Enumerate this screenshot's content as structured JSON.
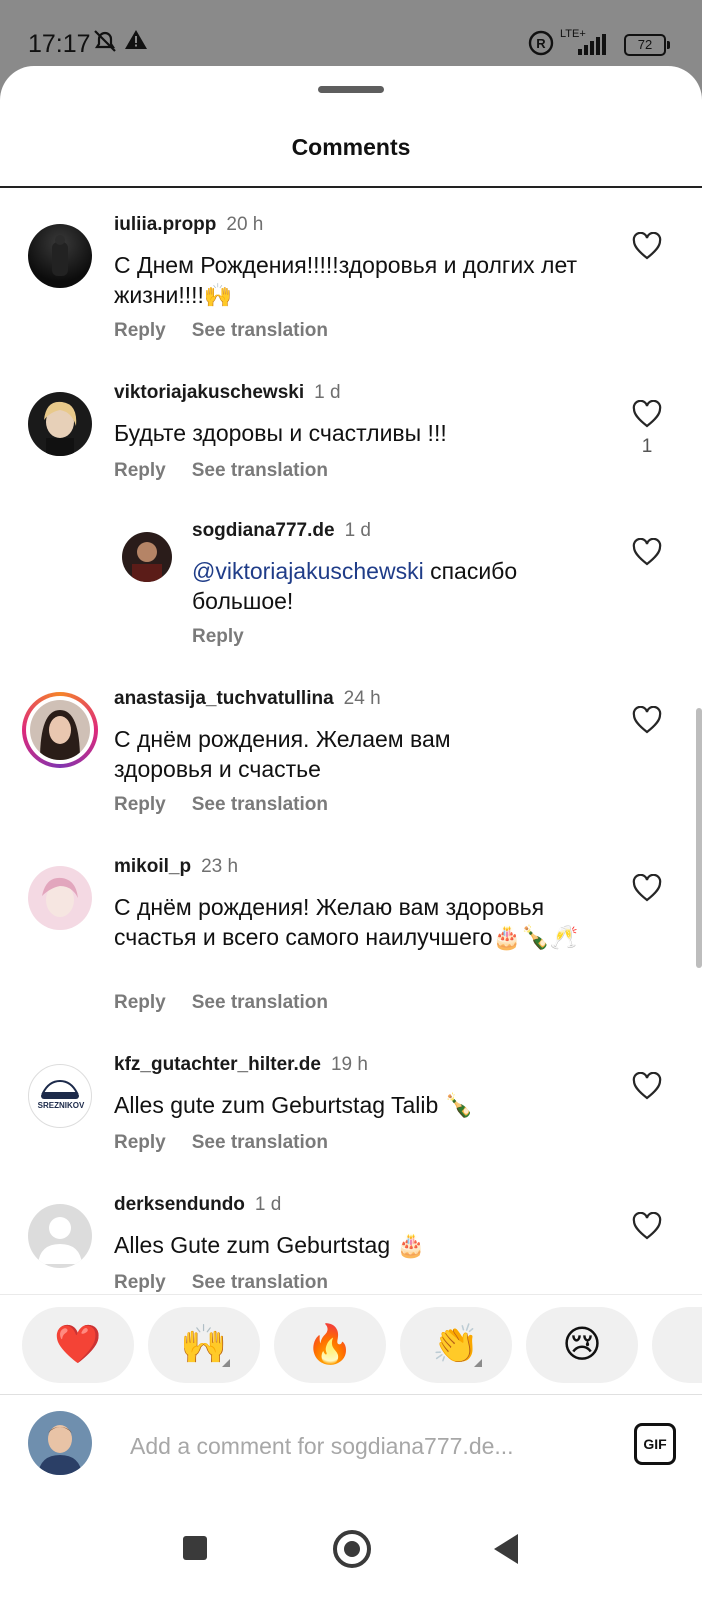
{
  "status_bar": {
    "time": "17:17",
    "network": "LTE+",
    "battery": "72",
    "icons": [
      "mute-icon",
      "warning-icon",
      "roaming-icon",
      "signal-icon",
      "battery-icon"
    ]
  },
  "sheet": {
    "title": "Comments"
  },
  "comments": [
    {
      "username": "iuliia.propp",
      "time": "20 h",
      "text": "С Днем Рождения!!!!!здоровья и долгих лет жизни!!!!🙌",
      "reply_label": "Reply",
      "translate_label": "See translation"
    },
    {
      "username": "viktoriajakuschewski",
      "time": "1 d",
      "text": "Будьте здоровы и счастливы !!!",
      "reply_label": "Reply",
      "translate_label": "See translation",
      "likes": "1"
    },
    {
      "username": "sogdiana777.de",
      "time": "1 d",
      "mention": "@viktoriajakuschewski",
      "text": " спасибо большое!",
      "reply_label": "Reply"
    },
    {
      "username": "anastasija_tuchvatullina",
      "time": "24 h",
      "text": "С днём рождения. Желаем вам здоровья и счастье",
      "reply_label": "Reply",
      "translate_label": "See translation"
    },
    {
      "username": "mikoil_p",
      "time": "23 h",
      "text": "С днём рождения!  Желаю вам здоровья счастья и всего самого наилучшего🎂🍾🥂",
      "reply_label": "Reply",
      "translate_label": "See translation"
    },
    {
      "username": "kfz_gutachter_hilter.de",
      "time": "19 h",
      "text": "Alles gute zum Geburtstag Talib 🍾",
      "reply_label": "Reply",
      "translate_label": "See translation",
      "avatar_logo_text": "SREZNIKOV"
    },
    {
      "username": "derksendundo",
      "time": "1 d",
      "text": "Alles Gute zum Geburtstag 🎂",
      "reply_label": "Reply",
      "translate_label": "See translation"
    }
  ],
  "reactions": [
    "❤️",
    "🙌",
    "🔥",
    "👏",
    "😢"
  ],
  "input": {
    "placeholder": "Add a comment for sogdiana777.de...",
    "gif_label": "GIF"
  },
  "colors": {
    "mention": "#1f3c88",
    "heart_outline": "#262626",
    "story_ring": "#dd2a7b"
  }
}
